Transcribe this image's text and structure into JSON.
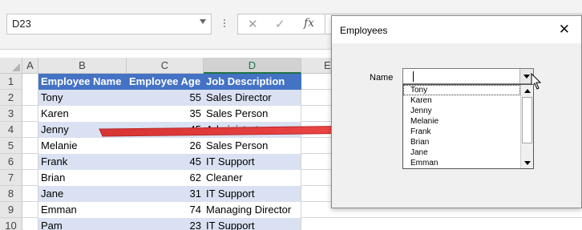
{
  "formula_bar": {
    "name_box": "D23",
    "cancel_icon": "✕",
    "enter_icon": "✓",
    "fx_label": "fx",
    "formula_value": ""
  },
  "sheet": {
    "column_headers": [
      "A",
      "B",
      "C",
      "D",
      "E"
    ],
    "row_numbers": [
      "1",
      "2",
      "3",
      "4",
      "5",
      "6",
      "7",
      "8",
      "9",
      "10"
    ],
    "table_headers": [
      "Employee Name",
      "Employee Age",
      "Job Description"
    ],
    "rows": [
      {
        "name": "Tony",
        "age": "55",
        "job": "Sales Director"
      },
      {
        "name": "Karen",
        "age": "35",
        "job": "Sales Person"
      },
      {
        "name": "Jenny",
        "age": "45",
        "job": "Administrator"
      },
      {
        "name": "Melanie",
        "age": "26",
        "job": "Sales Person"
      },
      {
        "name": "Frank",
        "age": "45",
        "job": "IT Support"
      },
      {
        "name": "Brian",
        "age": "62",
        "job": "Cleaner"
      },
      {
        "name": "Jane",
        "age": "31",
        "job": "IT Support"
      },
      {
        "name": "Emman",
        "age": "74",
        "job": "Managing Director"
      },
      {
        "name": "Pam",
        "age": "23",
        "job": "IT Support"
      }
    ],
    "selected_column": "D",
    "table_header_color": "#4472c4",
    "table_band_color": "#d9e1f2"
  },
  "annotation": {
    "arrow_color": "#e83e3e"
  },
  "dialog": {
    "title": "Employees",
    "close_icon": "✕",
    "name_label": "Name",
    "combo_value": "",
    "dropdown_items": [
      "Tony",
      "Karen",
      "Jenny",
      "Melanie",
      "Frank",
      "Brian",
      "Jane",
      "Emman"
    ]
  }
}
